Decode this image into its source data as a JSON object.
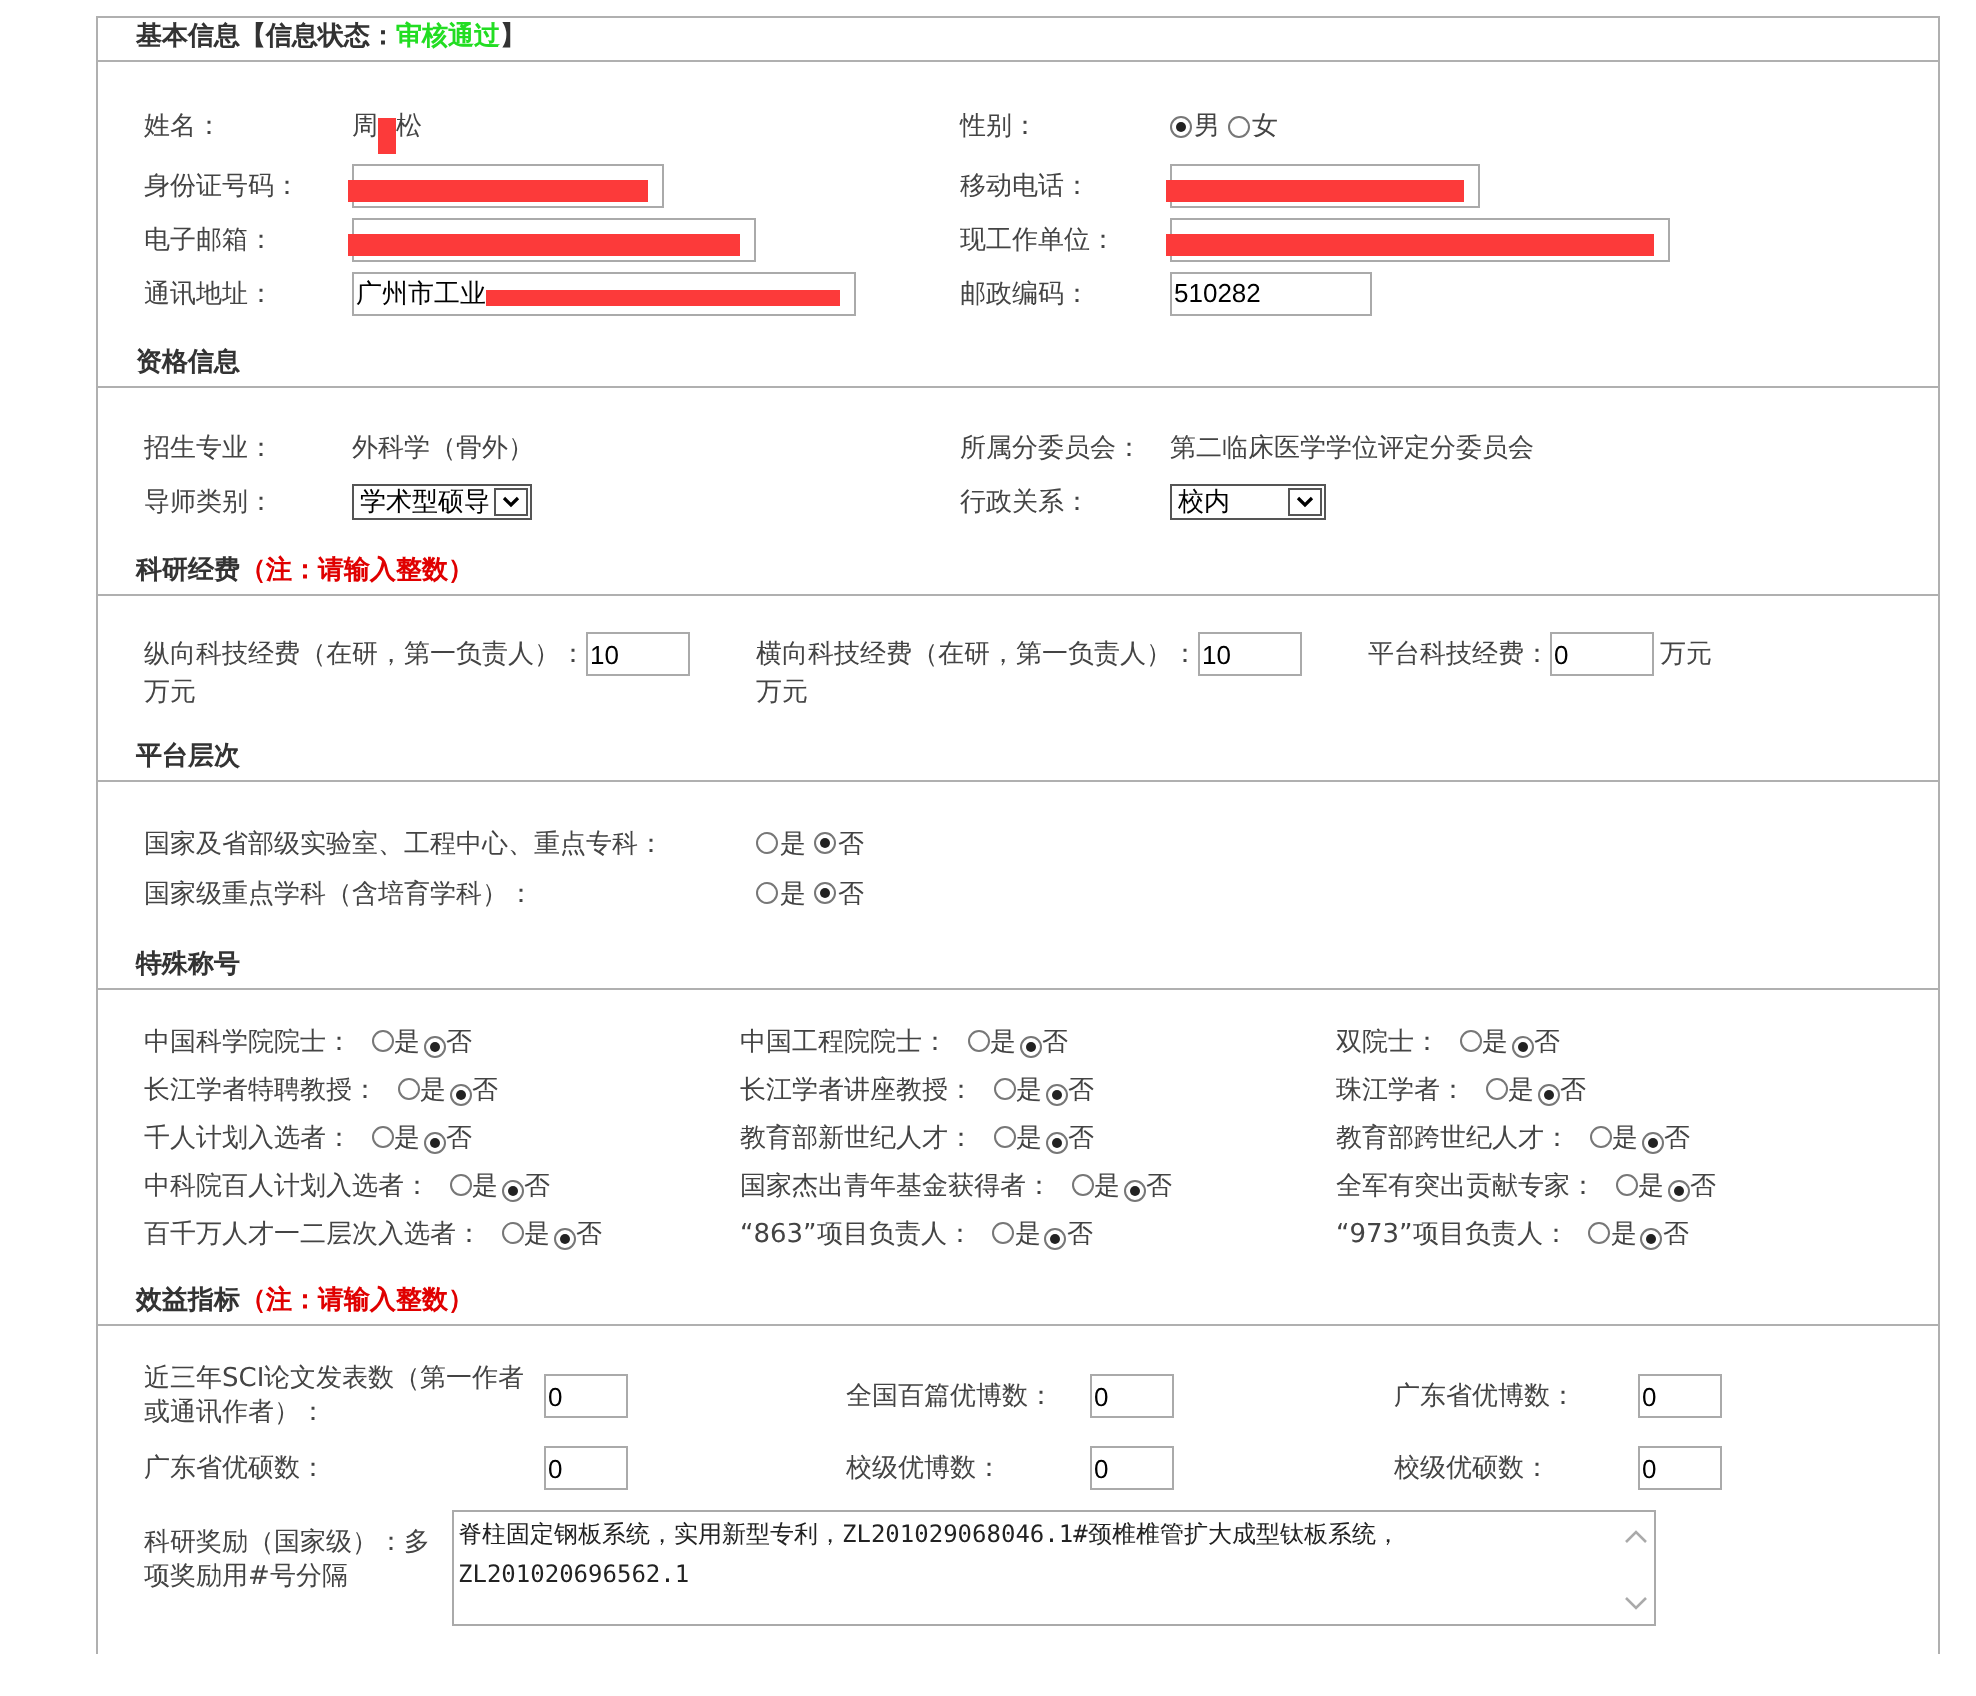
{
  "sections": [
    {
      "kind": "two_col",
      "title": "基本信息【信息状态：",
      "status": "审核通过",
      "title_end": "】",
      "fields": [
        {
          "kind": "text",
          "label": "姓名：",
          "value": "周",
          "value_end": "松",
          "redacted": true
        },
        {
          "kind": "radio",
          "label": "性别：",
          "options": [
            {
              "label": "男",
              "selected": true
            },
            {
              "label": "女",
              "selected": false
            }
          ]
        },
        {
          "kind": "input",
          "label": "身份证号码：",
          "redacted": true
        },
        {
          "kind": "input",
          "label": "移动电话：",
          "redacted": true
        },
        {
          "kind": "input",
          "label": "电子邮箱：",
          "redacted": true
        },
        {
          "kind": "input",
          "label": "现工作单位：",
          "redacted": true
        },
        {
          "kind": "input",
          "label": "通讯地址：",
          "value": "广州市工业",
          "redacted": true
        },
        {
          "kind": "input",
          "label": "邮政编码：",
          "value": "510282"
        }
      ]
    },
    {
      "kind": "two_col",
      "title": "资格信息",
      "fields": [
        {
          "kind": "text",
          "label": "招生专业：",
          "value": "外科学（骨外）"
        },
        {
          "kind": "text",
          "label": "所属分委员会：",
          "value": "第二临床医学学位评定分委员会"
        },
        {
          "kind": "select",
          "label": "导师类别：",
          "value": "学术型硕导"
        },
        {
          "kind": "select",
          "label": "行政关系：",
          "value": "校内"
        }
      ]
    },
    {
      "kind": "funding",
      "title": "科研经费",
      "note": "（注：请输入整数）",
      "fields": [
        {
          "kind": "input",
          "label": "纵向科技经费（在研，第一负责人）：",
          "value": "10",
          "unit": "万元"
        },
        {
          "kind": "input",
          "label": "横向科技经费（在研，第一负责人）：",
          "value": "10",
          "unit": "万元"
        },
        {
          "kind": "input",
          "label": "平台科技经费：",
          "value": "0",
          "unit": "万元"
        }
      ]
    },
    {
      "kind": "one_col",
      "title": "平台层次",
      "fields": [
        {
          "kind": "radio",
          "label": "国家及省部级实验室、工程中心、重点专科：",
          "options": [
            {
              "label": "是",
              "selected": false
            },
            {
              "label": "否",
              "selected": true
            }
          ]
        },
        {
          "kind": "radio",
          "label": "国家级重点学科（含培育学科）：",
          "options": [
            {
              "label": "是",
              "selected": false
            },
            {
              "label": "否",
              "selected": true
            }
          ]
        }
      ]
    },
    {
      "kind": "three_col",
      "title": "特殊称号",
      "fields": [
        {
          "kind": "radio",
          "label": "中国科学院院士：",
          "options": [
            {
              "label": "是",
              "selected": false
            },
            {
              "label": "否",
              "selected": true
            }
          ]
        },
        {
          "kind": "radio",
          "label": "中国工程院院士：",
          "options": [
            {
              "label": "是",
              "selected": false
            },
            {
              "label": "否",
              "selected": true
            }
          ]
        },
        {
          "kind": "radio",
          "label": "双院士：",
          "options": [
            {
              "label": "是",
              "selected": false
            },
            {
              "label": "否",
              "selected": true
            }
          ]
        },
        {
          "kind": "radio",
          "label": "长江学者特聘教授：",
          "options": [
            {
              "label": "是",
              "selected": false
            },
            {
              "label": "否",
              "selected": true
            }
          ]
        },
        {
          "kind": "radio",
          "label": "长江学者讲座教授：",
          "options": [
            {
              "label": "是",
              "selected": false
            },
            {
              "label": "否",
              "selected": true
            }
          ]
        },
        {
          "kind": "radio",
          "label": "珠江学者：",
          "options": [
            {
              "label": "是",
              "selected": false
            },
            {
              "label": "否",
              "selected": true
            }
          ]
        },
        {
          "kind": "radio",
          "label": "千人计划入选者：",
          "options": [
            {
              "label": "是",
              "selected": false
            },
            {
              "label": "否",
              "selected": true
            }
          ]
        },
        {
          "kind": "radio",
          "label": "教育部新世纪人才：",
          "options": [
            {
              "label": "是",
              "selected": false
            },
            {
              "label": "否",
              "selected": true
            }
          ]
        },
        {
          "kind": "radio",
          "label": "教育部跨世纪人才：",
          "options": [
            {
              "label": "是",
              "selected": false
            },
            {
              "label": "否",
              "selected": true
            }
          ]
        },
        {
          "kind": "radio",
          "label": "中科院百人计划入选者：",
          "options": [
            {
              "label": "是",
              "selected": false
            },
            {
              "label": "否",
              "selected": true
            }
          ]
        },
        {
          "kind": "radio",
          "label": "国家杰出青年基金获得者：",
          "options": [
            {
              "label": "是",
              "selected": false
            },
            {
              "label": "否",
              "selected": true
            }
          ]
        },
        {
          "kind": "radio",
          "label": "全军有突出贡献专家：",
          "options": [
            {
              "label": "是",
              "selected": false
            },
            {
              "label": "否",
              "selected": true
            }
          ]
        },
        {
          "kind": "radio",
          "label": "百千万人才一二层次入选者：",
          "options": [
            {
              "label": "是",
              "selected": false
            },
            {
              "label": "否",
              "selected": true
            }
          ]
        },
        {
          "kind": "radio",
          "label": "“863”项目负责人：",
          "options": [
            {
              "label": "是",
              "selected": false
            },
            {
              "label": "否",
              "selected": true
            }
          ]
        },
        {
          "kind": "radio",
          "label": "“973”项目负责人：",
          "options": [
            {
              "label": "是",
              "selected": false
            },
            {
              "label": "否",
              "selected": true
            }
          ]
        }
      ]
    },
    {
      "kind": "metrics",
      "title": "效益指标",
      "note": "（注：请输入整数）",
      "fields": [
        {
          "kind": "input",
          "label": "近三年SCI论文发表数（第一作者或通讯作者）：",
          "value": "0"
        },
        {
          "kind": "input",
          "label": "全国百篇优博数：",
          "value": "0"
        },
        {
          "kind": "input",
          "label": "广东省优博数：",
          "value": "0"
        },
        {
          "kind": "input",
          "label": "广东省优硕数：",
          "value": "0"
        },
        {
          "kind": "input",
          "label": "校级优博数：",
          "value": "0"
        },
        {
          "kind": "input",
          "label": "校级优硕数：",
          "value": "0"
        },
        {
          "kind": "textarea",
          "label": "科研奖励（国家级）：多项奖励用#号分隔",
          "value": "脊柱固定钢板系统，实用新型专利，ZL201029068046.1#颈椎椎管扩大成型钛板系统，ZL201020696562.1"
        }
      ]
    }
  ]
}
